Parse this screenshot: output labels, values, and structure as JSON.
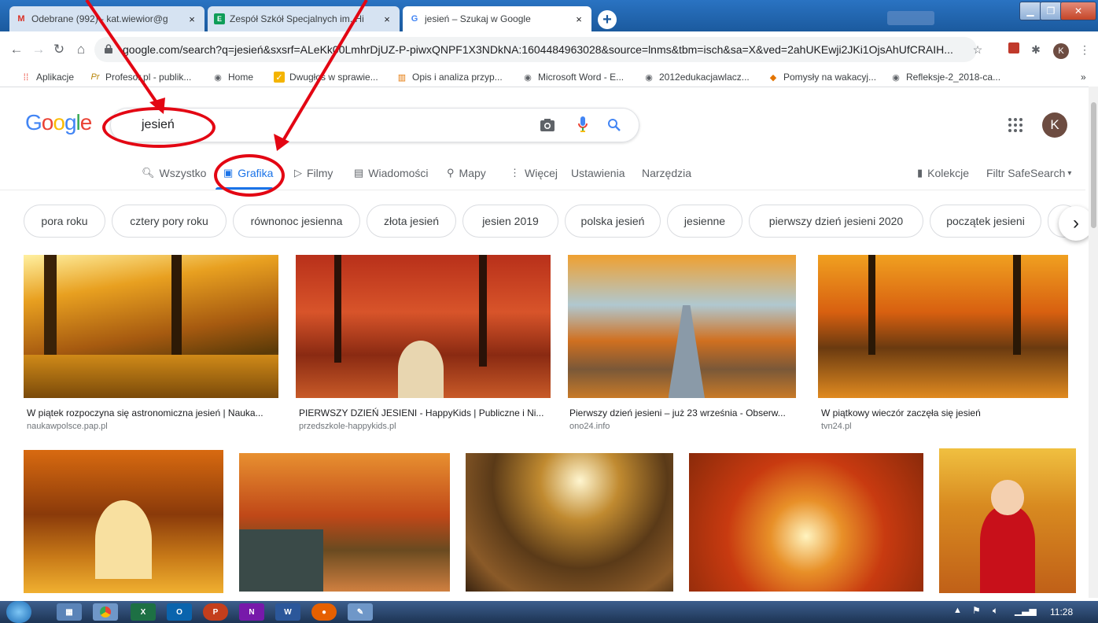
{
  "browser": {
    "tabs": [
      {
        "title": "Odebrane (992) - kat.wiewior@g",
        "close": "×"
      },
      {
        "title": "Zespół Szkół Specjalnych im. Hi",
        "close": "×"
      },
      {
        "title": "jesień – Szukaj w Google",
        "close": "×"
      }
    ],
    "new_tab": "+",
    "url": "google.com/search?q=jesień&sxsrf=ALeKk00LmhrDjUZ-P-piwxQNPF1X3NDkNA:1604484963028&source=lnms&tbm=isch&sa=X&ved=2ahUKEwji2JKi1OjsAhUfCRAIH...",
    "profile_initial": "K",
    "bookmarks": [
      "Aplikacje",
      "Profesor.pl - publik...",
      "Home",
      "Dwugłos w sprawie...",
      "Opis i analiza przyp...",
      "Microsoft Word - E...",
      "2012edukacjawlacz...",
      "Pomysły na wakacyj...",
      "Refleksje-2_2018-ca..."
    ],
    "bookmarks_more": "»"
  },
  "google": {
    "logo": [
      "G",
      "o",
      "o",
      "g",
      "l",
      "e"
    ],
    "logo_colors": [
      "#4285f4",
      "#ea4335",
      "#fbbc05",
      "#4285f4",
      "#34a853",
      "#ea4335"
    ],
    "query": "jesień",
    "avatar_initial": "K",
    "tabs": [
      "Wszystko",
      "Grafika",
      "Filmy",
      "Wiadomości",
      "Mapy",
      "Więcej",
      "Ustawienia",
      "Narzędzia"
    ],
    "right_links": {
      "collections": "Kolekcje",
      "safesearch": "Filtr SafeSearch"
    },
    "chips": [
      "pora roku",
      "cztery pory roku",
      "równonoc jesienna",
      "złota jesień",
      "jesien 2019",
      "polska jesień",
      "jesienne",
      "pierwszy dzień jesieni 2020",
      "początek jesieni"
    ],
    "results_row1": [
      {
        "caption": "W piątek rozpoczyna się astronomiczna jesień | Nauka...",
        "source": "naukawpolsce.pap.pl"
      },
      {
        "caption": "PIERWSZY DZIEŃ JESIENI - HappyKids | Publiczne i Ni...",
        "source": "przedszkole-happykids.pl"
      },
      {
        "caption": "Pierwszy dzień jesieni – już 23 września - Obserw...",
        "source": "ono24.info"
      },
      {
        "caption": "W piątkowy wieczór zaczęła się jesień",
        "source": "tvn24.pl"
      }
    ]
  },
  "taskbar": {
    "clock": "11:28",
    "apps": [
      "X",
      "O",
      "P",
      "N",
      "W"
    ]
  },
  "colors": {
    "accent": "#1a73e8",
    "annotation": "#e30613"
  }
}
